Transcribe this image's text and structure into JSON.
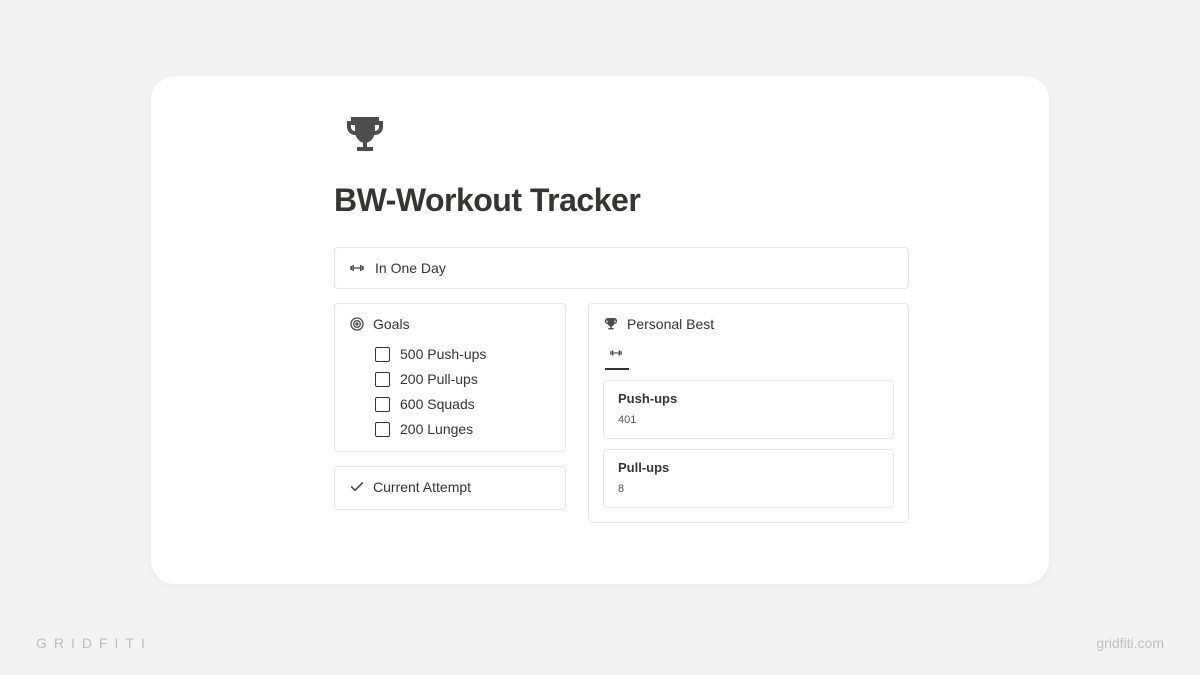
{
  "page": {
    "title": "BW-Workout Tracker"
  },
  "callout": {
    "label": "In One Day"
  },
  "goals": {
    "heading": "Goals",
    "items": [
      {
        "label": "500 Push-ups"
      },
      {
        "label": "200 Pull-ups"
      },
      {
        "label": "600 Squads"
      },
      {
        "label": "200 Lunges"
      }
    ]
  },
  "current": {
    "heading": "Current Attempt"
  },
  "personal_best": {
    "heading": "Personal Best",
    "items": [
      {
        "name": "Push-ups",
        "value": "401"
      },
      {
        "name": "Pull-ups",
        "value": "8"
      }
    ]
  },
  "branding": {
    "left": "GRIDFITI",
    "right": "gridfiti.com"
  }
}
